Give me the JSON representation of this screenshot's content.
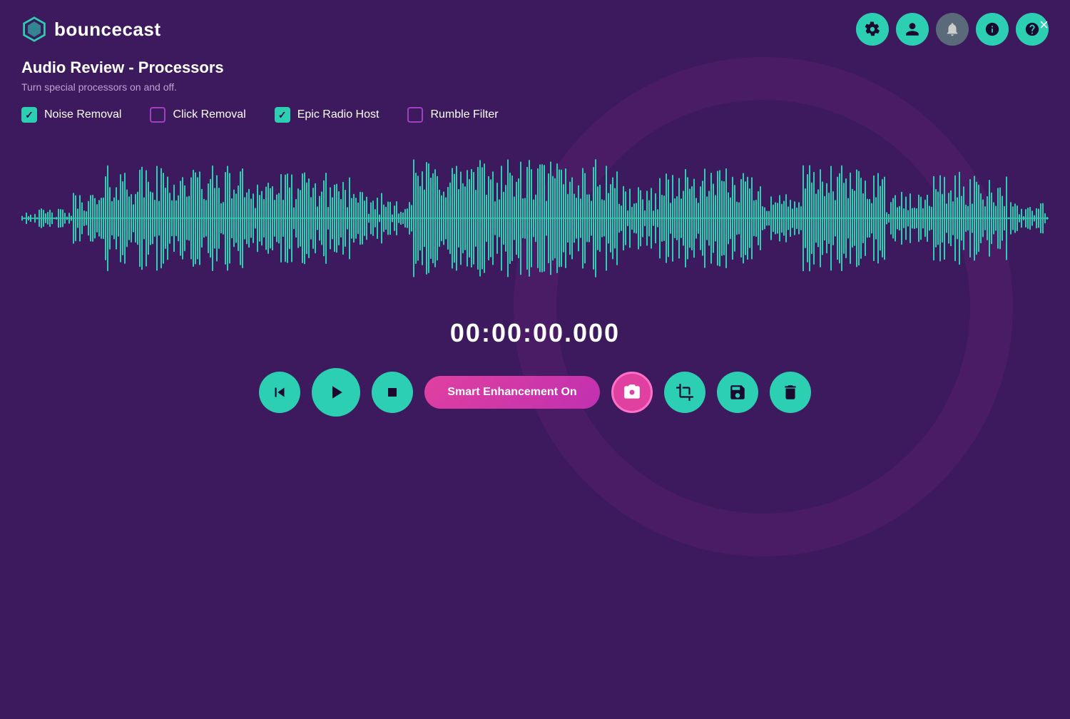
{
  "app": {
    "name": "bouncecast",
    "logo_alt": "bouncecast logo"
  },
  "header": {
    "close_label": "×",
    "icons": [
      {
        "name": "settings-icon",
        "symbol": "🔧",
        "class": "teal"
      },
      {
        "name": "user-icon",
        "symbol": "👤",
        "class": "teal"
      },
      {
        "name": "notifications-icon",
        "symbol": "🔔",
        "class": "gray"
      },
      {
        "name": "info-icon",
        "symbol": "ℹ",
        "class": "teal"
      },
      {
        "name": "help-icon",
        "symbol": "?",
        "class": "teal"
      }
    ]
  },
  "page": {
    "title": "Audio Review - Processors",
    "subtitle": "Turn special processors on and off."
  },
  "processors": [
    {
      "id": "noise-removal",
      "label": "Noise Removal",
      "checked": true
    },
    {
      "id": "click-removal",
      "label": "Click Removal",
      "checked": false
    },
    {
      "id": "epic-radio-host",
      "label": "Epic Radio Host",
      "checked": true
    },
    {
      "id": "rumble-filter",
      "label": "Rumble Filter",
      "checked": false
    }
  ],
  "player": {
    "timestamp": "00:00:00.000",
    "smart_enhancement_label": "Smart Enhancement On"
  },
  "controls": [
    {
      "name": "rewind-button",
      "symbol": "⏮",
      "class": "ctrl-btn"
    },
    {
      "name": "play-button",
      "symbol": "▶",
      "class": "ctrl-btn play-btn"
    },
    {
      "name": "stop-button",
      "symbol": "⏹",
      "class": "ctrl-btn"
    }
  ],
  "action_buttons": [
    {
      "name": "camera-button",
      "symbol": "📷",
      "class": "action-btn camera-btn"
    },
    {
      "name": "crop-button",
      "symbol": "✂",
      "class": "action-btn"
    },
    {
      "name": "save-button",
      "symbol": "💾",
      "class": "action-btn"
    },
    {
      "name": "delete-button",
      "symbol": "🗑",
      "class": "action-btn"
    }
  ],
  "colors": {
    "bg": "#3d1a5e",
    "teal": "#2dcfb3",
    "pink": "#e040a0",
    "purple_dark": "#2a0a45",
    "text_white": "#ffffff",
    "text_muted": "#c0a0d0"
  }
}
